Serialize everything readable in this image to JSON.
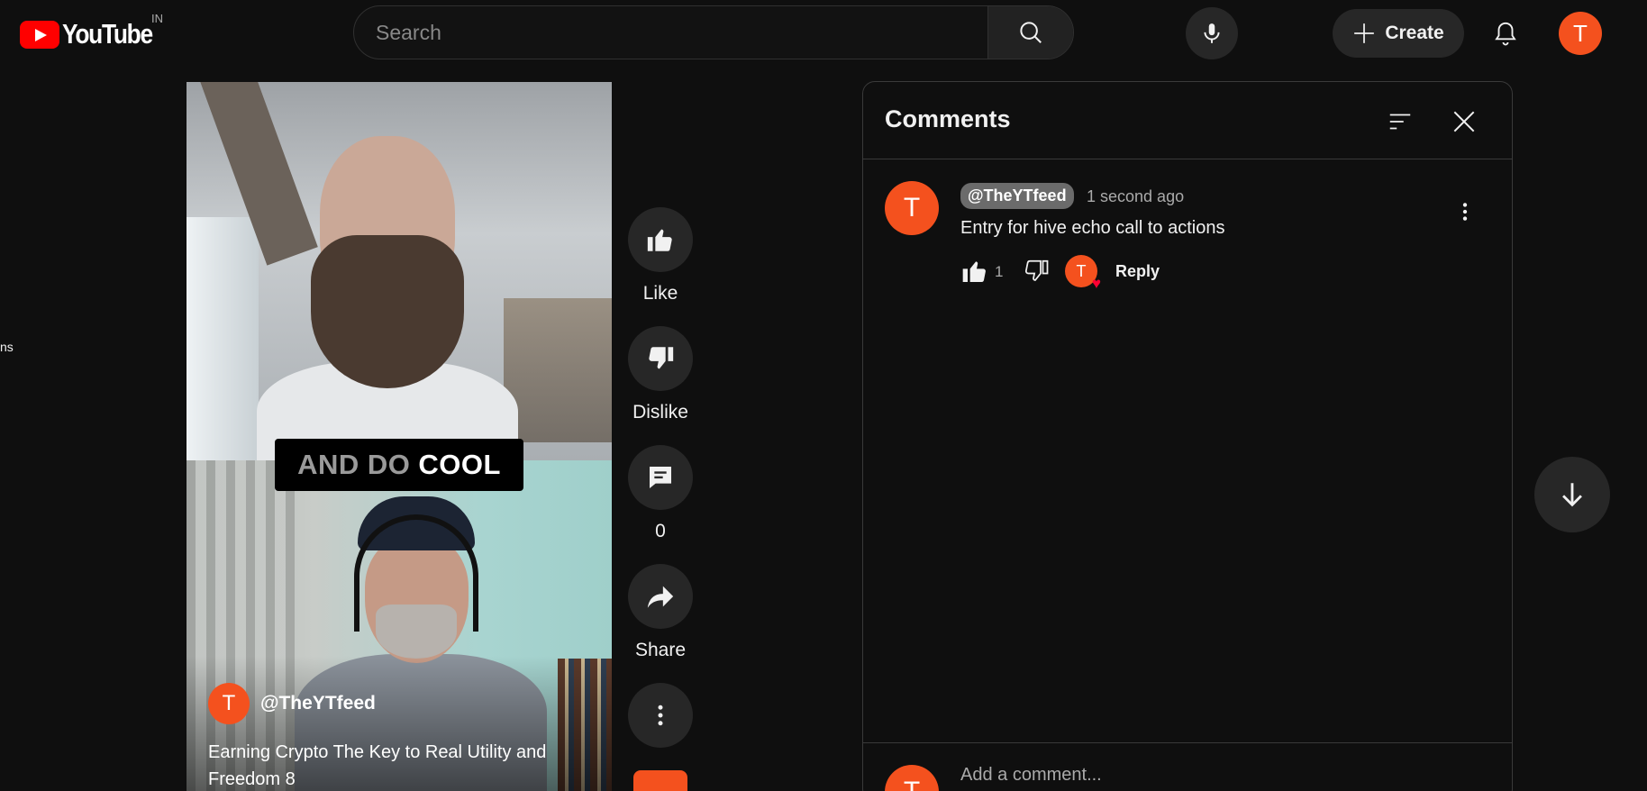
{
  "header": {
    "logo_text": "YouTube",
    "region": "IN",
    "search_placeholder": "Search",
    "create_label": "Create",
    "account_initial": "T"
  },
  "sidebar": {
    "fragment": "ns"
  },
  "video": {
    "caption_dim": "AND DO",
    "caption_bright": "COOL",
    "channel_initial": "T",
    "channel_name": "@TheYTfeed",
    "title": "Earning Crypto  The Key to Real Utility and Freedom 8"
  },
  "actions": {
    "like_label": "Like",
    "dislike_label": "Dislike",
    "comments_count": "0",
    "share_label": "Share"
  },
  "comments": {
    "title": "Comments",
    "items": [
      {
        "initial": "T",
        "author": "@TheYTfeed",
        "time": "1 second ago",
        "text": "Entry for hive echo call to actions",
        "likes": "1",
        "hearted_by_initial": "T",
        "reply_label": "Reply"
      }
    ],
    "footer": {
      "initial": "T",
      "placeholder": "Add a comment..."
    }
  },
  "colors": {
    "background": "#0f0f0f",
    "brand_red": "#ff0000",
    "avatar_orange": "#f4511e",
    "button_bg": "#272727"
  },
  "icons": [
    "search-icon",
    "microphone-icon",
    "plus-icon",
    "bell-icon",
    "thumbs-up-icon",
    "thumbs-down-icon",
    "comment-icon",
    "share-icon",
    "more-vertical-icon",
    "sort-icon",
    "close-icon",
    "heart-icon",
    "arrow-down-icon"
  ]
}
